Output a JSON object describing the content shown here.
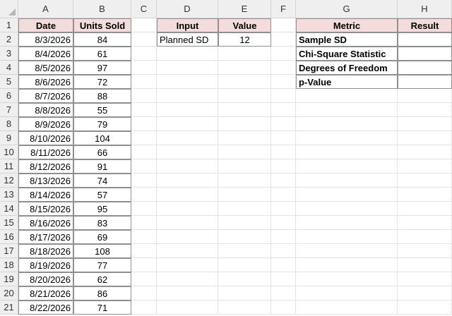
{
  "columns": [
    "A",
    "B",
    "C",
    "D",
    "E",
    "F",
    "G",
    "H"
  ],
  "rows": [
    "1",
    "2",
    "3",
    "4",
    "5",
    "6",
    "7",
    "8",
    "9",
    "10",
    "11",
    "12",
    "13",
    "14",
    "15",
    "16",
    "17",
    "18",
    "19",
    "20",
    "21"
  ],
  "data_table": {
    "headers": [
      "Date",
      "Units Sold"
    ],
    "rows": [
      [
        "8/3/2026",
        "84"
      ],
      [
        "8/4/2026",
        "61"
      ],
      [
        "8/5/2026",
        "97"
      ],
      [
        "8/6/2026",
        "72"
      ],
      [
        "8/7/2026",
        "88"
      ],
      [
        "8/8/2026",
        "55"
      ],
      [
        "8/9/2026",
        "79"
      ],
      [
        "8/10/2026",
        "104"
      ],
      [
        "8/11/2026",
        "66"
      ],
      [
        "8/12/2026",
        "91"
      ],
      [
        "8/13/2026",
        "74"
      ],
      [
        "8/14/2026",
        "57"
      ],
      [
        "8/15/2026",
        "95"
      ],
      [
        "8/16/2026",
        "83"
      ],
      [
        "8/17/2026",
        "69"
      ],
      [
        "8/18/2026",
        "108"
      ],
      [
        "8/19/2026",
        "77"
      ],
      [
        "8/20/2026",
        "62"
      ],
      [
        "8/21/2026",
        "86"
      ],
      [
        "8/22/2026",
        "71"
      ]
    ]
  },
  "input_table": {
    "headers": [
      "Input",
      "Value"
    ],
    "rows": [
      [
        "Planned SD",
        "12"
      ]
    ]
  },
  "metrics_table": {
    "headers": [
      "Metric",
      "Result"
    ],
    "rows": [
      [
        "Sample SD",
        ""
      ],
      [
        "Chi-Square Statistic",
        ""
      ],
      [
        "Degrees of Freedom",
        ""
      ],
      [
        "p-Value",
        ""
      ]
    ]
  },
  "colors": {
    "header_fill": "#f4dcdc",
    "grid_header_bg": "#efefef",
    "cell_border": "#8f8f8f"
  }
}
